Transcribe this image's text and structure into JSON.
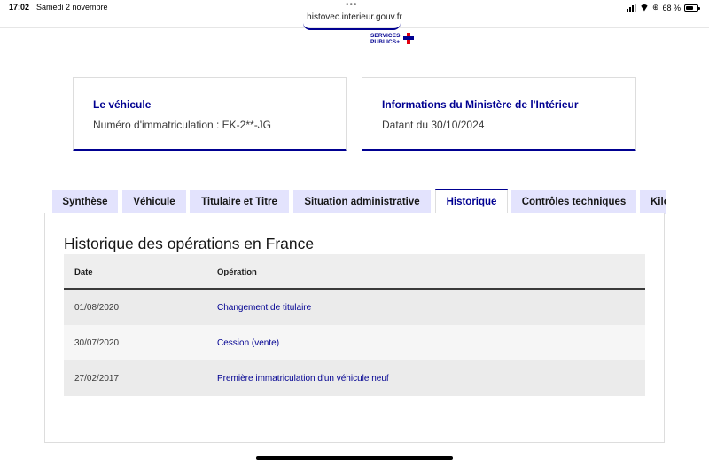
{
  "status_bar": {
    "time": "17:02",
    "date": "Samedi 2 novembre",
    "url": "histovec.interieur.gouv.fr",
    "battery": "68 %",
    "battery_level": 0.68
  },
  "logo": {
    "line1": "SERVICES",
    "line2": "PUBLICS+"
  },
  "cards": [
    {
      "title": "Le véhicule",
      "text": "Numéro d'immatriculation : EK-2**-JG"
    },
    {
      "title": "Informations du Ministère de l'Intérieur",
      "text": "Datant du 30/10/2024"
    }
  ],
  "tabs": [
    {
      "label": "Synthèse",
      "active": false
    },
    {
      "label": "Véhicule",
      "active": false
    },
    {
      "label": "Titulaire et Titre",
      "active": false
    },
    {
      "label": "Situation administrative",
      "active": false
    },
    {
      "label": "Historique",
      "active": true
    },
    {
      "label": "Contrôles techniques",
      "active": false
    },
    {
      "label": "Kilo",
      "active": false
    }
  ],
  "history": {
    "title": "Historique des opérations en France",
    "columns": [
      "Date",
      "Opération"
    ],
    "rows": [
      {
        "date": "01/08/2020",
        "operation": "Changement de titulaire"
      },
      {
        "date": "30/07/2020",
        "operation": "Cession (vente)"
      },
      {
        "date": "27/02/2017",
        "operation": "Première immatriculation d'un véhicule neuf"
      }
    ]
  },
  "colors": {
    "accent": "#000091",
    "tab_bg": "#e3e3fd",
    "marianne_red": "#e1000f"
  }
}
